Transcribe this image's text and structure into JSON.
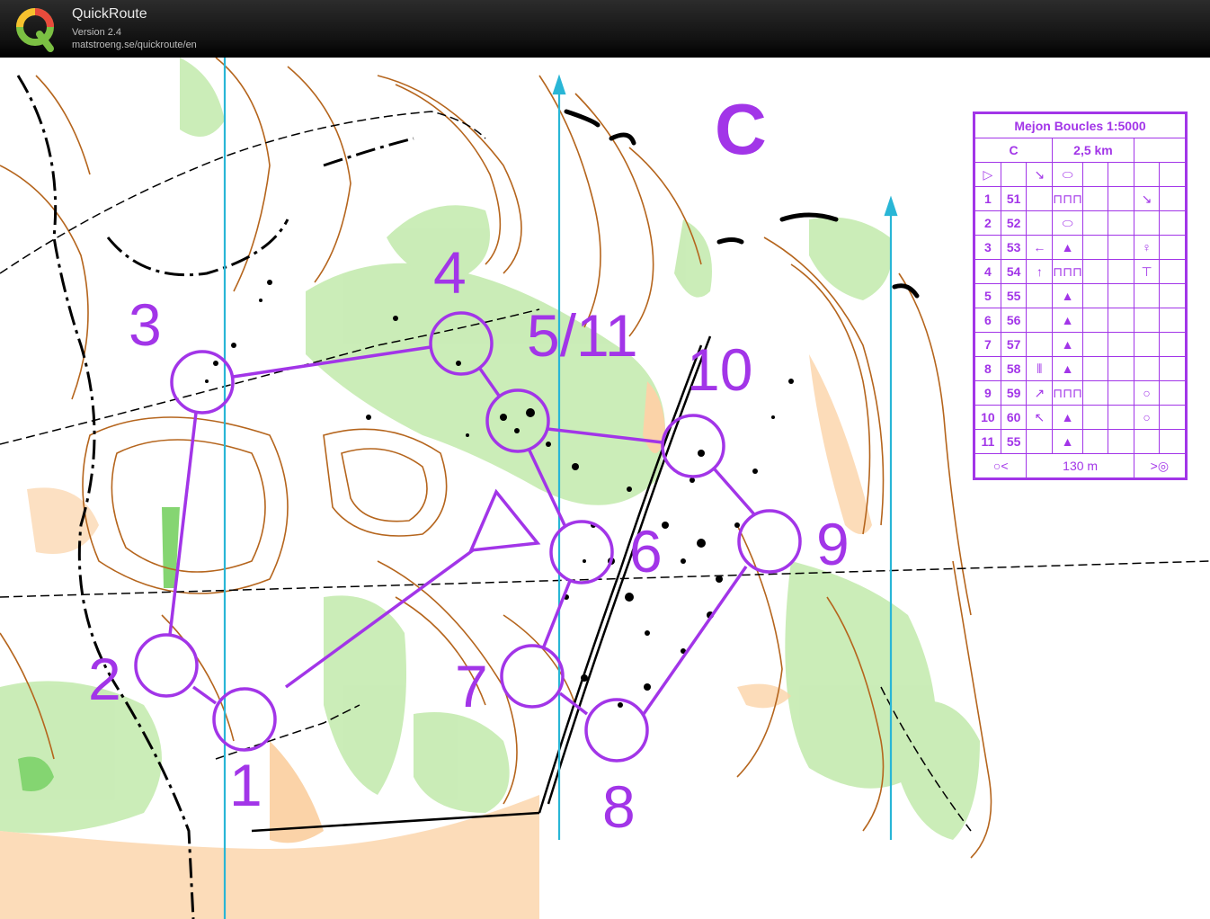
{
  "app": {
    "name": "QuickRoute",
    "version": "Version 2.4",
    "url": "matstroeng.se/quickroute/en"
  },
  "colors": {
    "course": "#a235e8",
    "contour": "#b5651d",
    "vegetation_light": "#c8ecb4",
    "vegetation_dark": "#7ed36a",
    "open_land": "#fbd3a8",
    "north_lines": "#29b6d6"
  },
  "map": {
    "course_letter": "C",
    "controls": [
      {
        "label": "1",
        "name": "control-1"
      },
      {
        "label": "2",
        "name": "control-2"
      },
      {
        "label": "3",
        "name": "control-3"
      },
      {
        "label": "4",
        "name": "control-4"
      },
      {
        "label": "5/11",
        "name": "control-5-11"
      },
      {
        "label": "6",
        "name": "control-6"
      },
      {
        "label": "7",
        "name": "control-7"
      },
      {
        "label": "8",
        "name": "control-8"
      },
      {
        "label": "9",
        "name": "control-9"
      },
      {
        "label": "10",
        "name": "control-10"
      }
    ]
  },
  "description_sheet": {
    "event": "Mejon Boucles 1:5000",
    "course": "C",
    "length": "2,5 km",
    "rows": [
      {
        "n": "1",
        "code": "51",
        "dir": "",
        "feature": "⊓⊓⊓",
        "extra": "↘"
      },
      {
        "n": "2",
        "code": "52",
        "dir": "",
        "feature": "⬭",
        "extra": ""
      },
      {
        "n": "3",
        "code": "53",
        "dir": "←",
        "feature": "▲",
        "extra": "♀"
      },
      {
        "n": "4",
        "code": "54",
        "dir": "↑",
        "feature": "⊓⊓⊓",
        "extra": "⊤"
      },
      {
        "n": "5",
        "code": "55",
        "dir": "",
        "feature": "▲",
        "extra": ""
      },
      {
        "n": "6",
        "code": "56",
        "dir": "",
        "feature": "▲",
        "extra": ""
      },
      {
        "n": "7",
        "code": "57",
        "dir": "",
        "feature": "▲",
        "extra": ""
      },
      {
        "n": "8",
        "code": "58",
        "dir": "⫴",
        "feature": "▲",
        "extra": ""
      },
      {
        "n": "9",
        "code": "59",
        "dir": "↗",
        "feature": "⊓⊓⊓",
        "extra": "○"
      },
      {
        "n": "10",
        "code": "60",
        "dir": "↖",
        "feature": "▲",
        "extra": "○"
      },
      {
        "n": "11",
        "code": "55",
        "dir": "",
        "feature": "▲",
        "extra": ""
      }
    ],
    "finish_distance": "130 m"
  }
}
